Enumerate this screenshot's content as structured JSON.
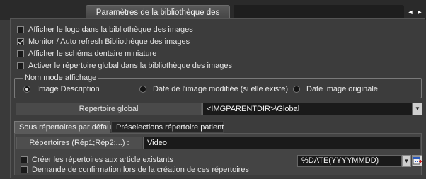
{
  "window": {
    "tab_title": "Paramètres de la bibliothèque des images",
    "nav_prev": "◄",
    "nav_next": "►"
  },
  "options": [
    {
      "label": "Afficher le logo dans la bibliothèque des images",
      "checked": false
    },
    {
      "label": "Monitor / Auto refresh Bibliothèque des images",
      "checked": true
    },
    {
      "label": "Afficher le schéma dentaire miniature",
      "checked": false
    },
    {
      "label": "Activer le répertoire global dans la bibliothèque des images",
      "checked": false
    }
  ],
  "display_mode": {
    "legend": "Nom mode affichage",
    "options": [
      {
        "label": "Image Description",
        "selected": true
      },
      {
        "label": "Date de l'image modifiée (si elle existe)",
        "selected": false
      },
      {
        "label": "Date image originale",
        "selected": false
      }
    ]
  },
  "global_dir": {
    "label": "Repertoire global",
    "value": "<IMGPARENTDIR>\\Global",
    "arrow": "▼"
  },
  "subtabs": [
    {
      "label": "Sous répertoires par défaut",
      "active": true
    },
    {
      "label": "Préselections répertoire patient",
      "active": false
    }
  ],
  "subdirs": {
    "label": "Répertoires (Rép1;Rép2;...) :",
    "value": "Video",
    "create_label": "Créer les répertoires aux article existants",
    "confirm_label": "Demande de confirmation lors de la création de ces répertoires",
    "date_format": "%DATE(YYYYMMDD)",
    "arrow": "▼"
  }
}
